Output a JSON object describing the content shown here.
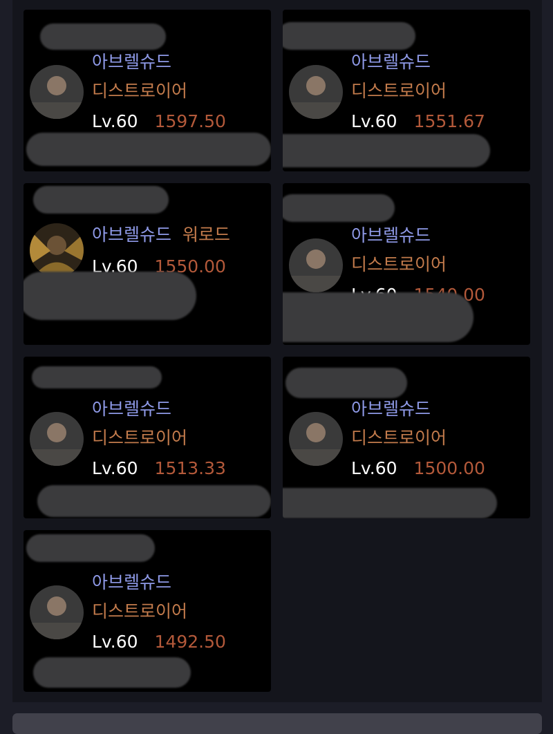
{
  "characters": [
    {
      "server": "아브렐슈드",
      "class": "디스트로이어",
      "level": "Lv.60",
      "item_level": "1597.50",
      "avatar": "destroyer-portrait"
    },
    {
      "server": "아브렐슈드",
      "class": "디스트로이어",
      "level": "Lv.60",
      "item_level": "1551.67",
      "avatar": "destroyer-portrait"
    },
    {
      "server": "아브렐슈드",
      "class": "워로드",
      "level": "Lv.60",
      "item_level": "1550.00",
      "avatar": "warlord-portrait"
    },
    {
      "server": "아브렐슈드",
      "class": "디스트로이어",
      "level": "Lv.60",
      "item_level": "1540.00",
      "avatar": "destroyer-portrait"
    },
    {
      "server": "아브렐슈드",
      "class": "디스트로이어",
      "level": "Lv.60",
      "item_level": "1513.33",
      "avatar": "destroyer-portrait"
    },
    {
      "server": "아브렐슈드",
      "class": "디스트로이어",
      "level": "Lv.60",
      "item_level": "1500.00",
      "avatar": "destroyer-portrait"
    },
    {
      "server": "아브렐슈드",
      "class": "디스트로이어",
      "level": "Lv.60",
      "item_level": "1492.50",
      "avatar": "destroyer-portrait"
    }
  ],
  "colors": {
    "background": "#1c1d27",
    "card": "#000000",
    "server": "#8f9ae8",
    "class": "#c37b4c",
    "level": "#ffffff",
    "item_level": "#b3593a",
    "redaction": "#3b3b3d"
  }
}
